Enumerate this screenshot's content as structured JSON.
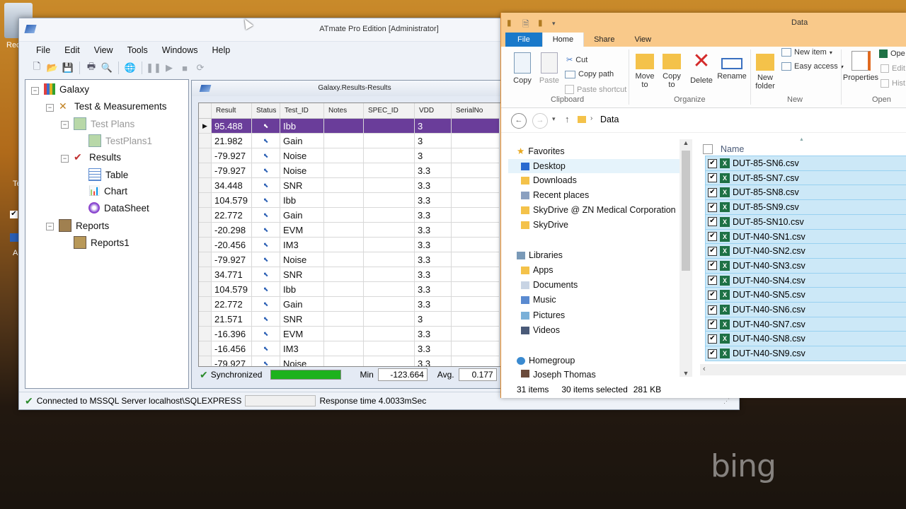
{
  "desktop": {
    "icon_label_1": "Rec",
    "icon_label_2": "Te",
    "icon_label_3": "A"
  },
  "atmate": {
    "title": "ATmate Pro Edition [Administrator]",
    "menu": [
      "File",
      "Edit",
      "View",
      "Tools",
      "Windows",
      "Help"
    ],
    "tree": {
      "root": "Galaxy",
      "test_measurements": "Test & Measurements",
      "test_plans": "Test Plans",
      "test_plans1": "TestPlans1",
      "results": "Results",
      "table": "Table",
      "chart": "Chart",
      "datasheet": "DataSheet",
      "reports": "Reports",
      "reports1": "Reports1"
    },
    "results_window": {
      "title": "Galaxy.Results-Results",
      "columns": [
        "Result",
        "Status",
        "Test_ID",
        "Notes",
        "SPEC_ID",
        "VDD",
        "SerialNo"
      ],
      "rows": [
        [
          "95.488",
          "Ibb",
          "3"
        ],
        [
          "21.982",
          "Gain",
          "3"
        ],
        [
          "-79.927",
          "Noise",
          "3"
        ],
        [
          "-79.927",
          "Noise",
          "3.3"
        ],
        [
          "34.448",
          "SNR",
          "3.3"
        ],
        [
          "104.579",
          "Ibb",
          "3.3"
        ],
        [
          "22.772",
          "Gain",
          "3.3"
        ],
        [
          "-20.298",
          "EVM",
          "3.3"
        ],
        [
          "-20.456",
          "IM3",
          "3.3"
        ],
        [
          "-79.927",
          "Noise",
          "3.3"
        ],
        [
          "34.771",
          "SNR",
          "3.3"
        ],
        [
          "104.579",
          "Ibb",
          "3.3"
        ],
        [
          "22.772",
          "Gain",
          "3.3"
        ],
        [
          "21.571",
          "SNR",
          "3"
        ],
        [
          "-16.396",
          "EVM",
          "3.3"
        ],
        [
          "-16.456",
          "IM3",
          "3.3"
        ],
        [
          "-79.927",
          "Noise",
          "3.3"
        ]
      ],
      "sync_label": "Synchronized",
      "min_label": "Min",
      "min_value": "-123.664",
      "avg_label": "Avg.",
      "avg_value": "0.177"
    },
    "status": {
      "connection": "Connected to MSSQL Server localhost\\SQLEXPRESS",
      "response": "Response time 4.0033mSec"
    }
  },
  "explorer": {
    "title": "Data",
    "tabs": {
      "file": "File",
      "home": "Home",
      "share": "Share",
      "view": "View"
    },
    "ribbon": {
      "copy": "Copy",
      "paste": "Paste",
      "cut": "Cut",
      "copy_path": "Copy path",
      "paste_shortcut": "Paste shortcut",
      "clipboard": "Clipboard",
      "move_to": "Move to",
      "copy_to": "Copy to",
      "delete": "Delete",
      "rename": "Rename",
      "organize": "Organize",
      "new_folder": "New folder",
      "new_item": "New item",
      "easy_access": "Easy access",
      "new": "New",
      "properties": "Properties",
      "open_trunc": "Ope",
      "edit_trunc": "Edit",
      "hist_trunc": "Hist",
      "open": "Open"
    },
    "breadcrumb": "Data",
    "nav": {
      "favorites": "Favorites",
      "desktop": "Desktop",
      "downloads": "Downloads",
      "recent": "Recent places",
      "skydrive_zn": "SkyDrive @ ZN Medical Corporation",
      "skydrive": "SkyDrive",
      "libraries": "Libraries",
      "apps": "Apps",
      "documents": "Documents",
      "music": "Music",
      "pictures": "Pictures",
      "videos": "Videos",
      "homegroup": "Homegroup",
      "user": "Joseph Thomas"
    },
    "name_header": "Name",
    "files": [
      "DUT-85-SN6.csv",
      "DUT-85-SN7.csv",
      "DUT-85-SN8.csv",
      "DUT-85-SN9.csv",
      "DUT-85-SN10.csv",
      "DUT-N40-SN1.csv",
      "DUT-N40-SN2.csv",
      "DUT-N40-SN3.csv",
      "DUT-N40-SN4.csv",
      "DUT-N40-SN5.csv",
      "DUT-N40-SN6.csv",
      "DUT-N40-SN7.csv",
      "DUT-N40-SN8.csv",
      "DUT-N40-SN9.csv"
    ],
    "status": {
      "items": "31 items",
      "selected": "30 items selected",
      "size": "281 KB"
    }
  },
  "wallpaper": {
    "logo": "bing"
  },
  "colors": {
    "selection": "#6a3d9a",
    "explorer_accent": "#f9c98a",
    "file_tab": "#1979ca",
    "sync_bar": "#1db21d"
  }
}
